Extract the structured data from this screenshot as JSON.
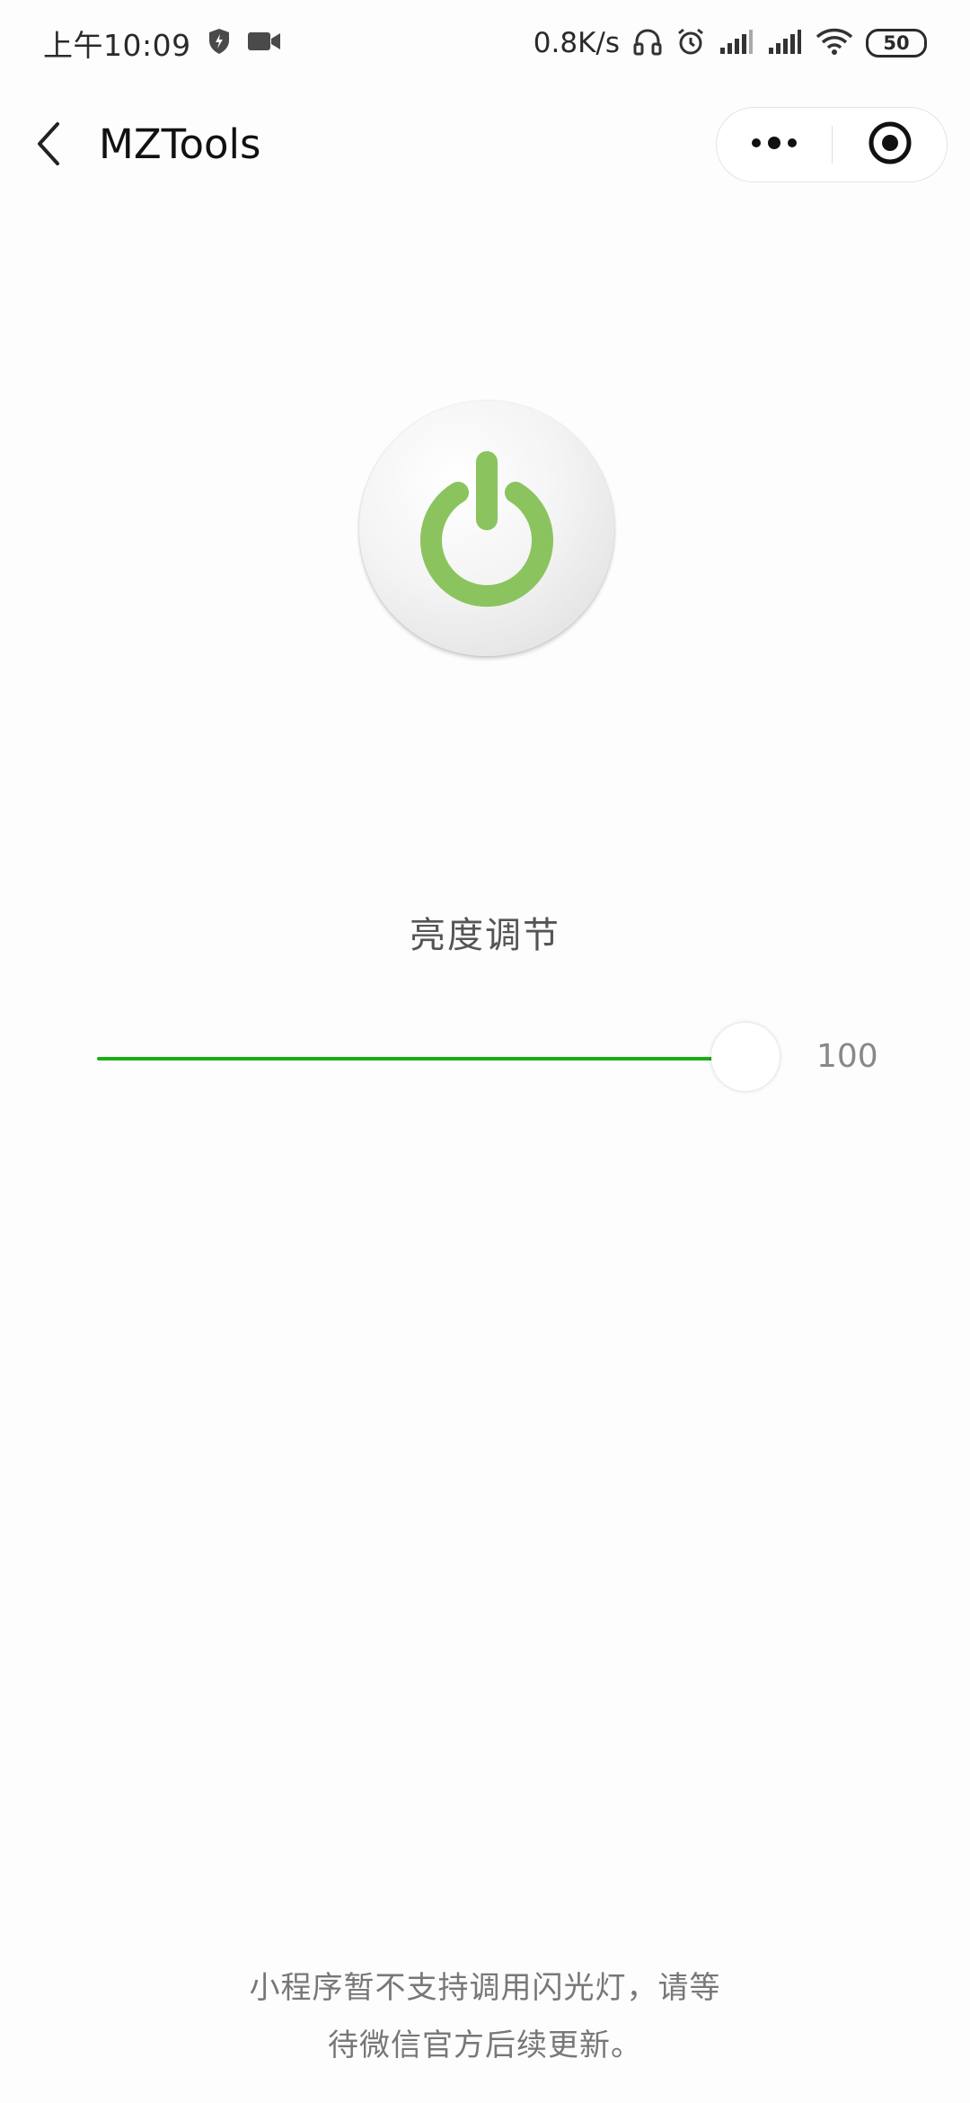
{
  "status_bar": {
    "time": "上午10:09",
    "net_speed": "0.8K/s",
    "battery_level": "50",
    "icons": [
      "shield-icon",
      "video-camera-icon",
      "headset-icon",
      "alarm-icon",
      "signal-icon",
      "signal-icon",
      "wifi-icon",
      "battery-icon"
    ]
  },
  "nav": {
    "title": "MZTools",
    "back_icon": "chevron-left-icon",
    "more_icon": "more-dots-icon",
    "close_icon": "target-close-icon"
  },
  "main": {
    "power_icon": "power-icon",
    "power_color": "#8bc45e",
    "brightness_label": "亮度调节",
    "slider": {
      "value": 100,
      "min": 0,
      "max": 100,
      "display_value": "100",
      "active_color": "#1aad19"
    }
  },
  "footer": {
    "notice_line1": "小程序暂不支持调用闪光灯，请等",
    "notice_line2": "待微信官方后续更新。"
  }
}
